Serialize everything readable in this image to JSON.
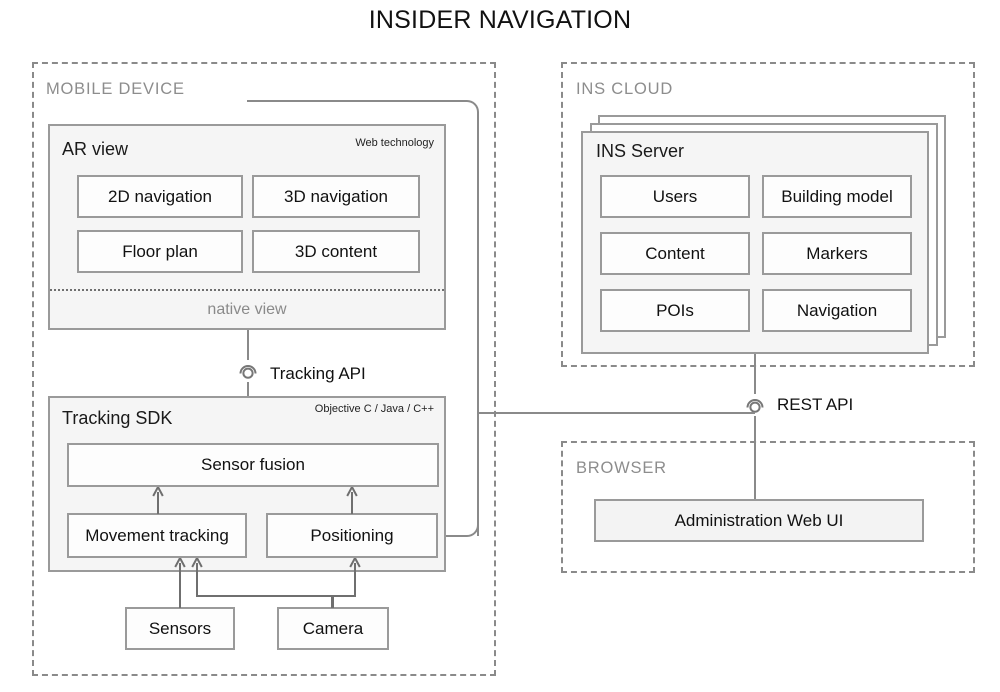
{
  "title": "INSIDER NAVIGATION",
  "zones": {
    "mobile_device": {
      "label": "MOBILE DEVICE"
    },
    "ins_cloud": {
      "label": "INS CLOUD"
    },
    "browser": {
      "label": "BROWSER"
    }
  },
  "ar_view": {
    "title": "AR view",
    "tech": "Web technology",
    "modules": [
      "2D navigation",
      "3D navigation",
      "Floor plan",
      "3D content"
    ],
    "native_view": "native view"
  },
  "tracking_sdk": {
    "title": "Tracking SDK",
    "tech": "Objective C / Java / C++",
    "sensor_fusion": "Sensor fusion",
    "movement_tracking": "Movement tracking",
    "positioning": "Positioning"
  },
  "hardware": {
    "sensors": "Sensors",
    "camera": "Camera"
  },
  "ins_server": {
    "title": "INS Server",
    "modules": [
      "Users",
      "Building model",
      "Content",
      "Markers",
      "POIs",
      "Navigation"
    ]
  },
  "browser": {
    "admin_ui": "Administration Web UI"
  },
  "apis": {
    "tracking_api": "Tracking API",
    "rest_api": "REST API"
  },
  "colors": {
    "stroke": "#9a9a9a",
    "zone_stroke": "#8a8a8a",
    "panel_fill": "#f5f5f5",
    "leaf_fill": "#fdfdfd",
    "shaded_fill": "#f3f3f3",
    "text": "#111111",
    "muted_text": "#8a8a8a"
  }
}
